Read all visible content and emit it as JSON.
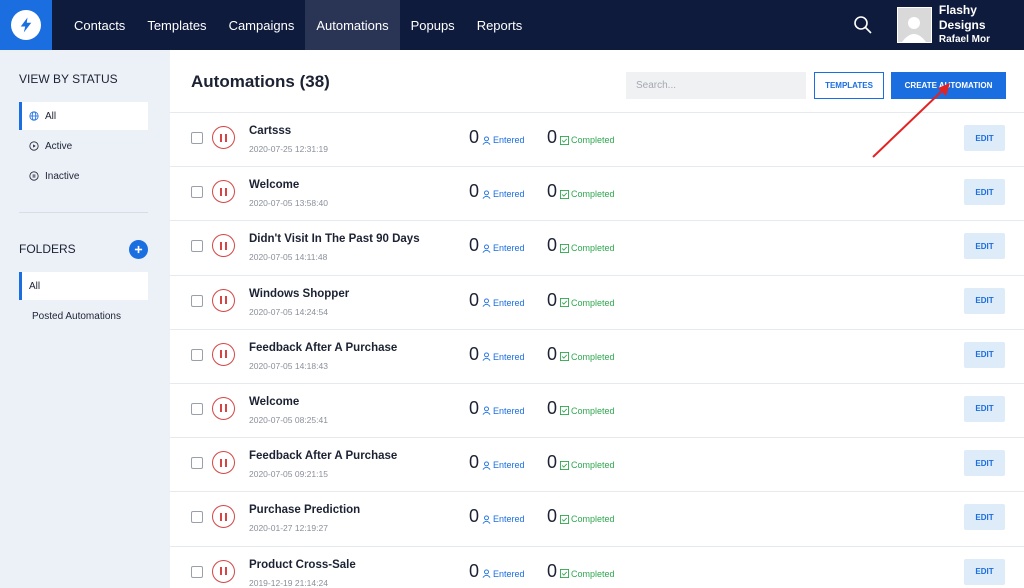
{
  "nav": {
    "items": [
      {
        "label": "Contacts",
        "active": false
      },
      {
        "label": "Templates",
        "active": false
      },
      {
        "label": "Campaigns",
        "active": false
      },
      {
        "label": "Automations",
        "active": true
      },
      {
        "label": "Popups",
        "active": false
      },
      {
        "label": "Reports",
        "active": false
      }
    ]
  },
  "user": {
    "name": "Flashy Designs",
    "sub": "Rafael Mor"
  },
  "sidebar": {
    "status_heading": "VIEW BY STATUS",
    "status_items": [
      {
        "label": "All",
        "icon": "globe-icon",
        "active": true
      },
      {
        "label": "Active",
        "icon": "play-circle-icon",
        "active": false
      },
      {
        "label": "Inactive",
        "icon": "pause-circle-icon",
        "active": false
      }
    ],
    "folders_heading": "FOLDERS",
    "folder_items": [
      {
        "label": "All",
        "active": true
      },
      {
        "label": "Posted Automations",
        "active": false
      }
    ]
  },
  "main": {
    "title": "Automations (38)",
    "search_placeholder": "Search...",
    "templates_label": "TEMPLATES",
    "create_label": "CREATE AUTOMATION",
    "entered_label": "Entered",
    "completed_label": "Completed",
    "edit_label": "EDIT",
    "rows": [
      {
        "name": "Cartsss",
        "date": "2020-07-25 12:31:19",
        "entered": "0",
        "completed": "0"
      },
      {
        "name": "Welcome",
        "date": "2020-07-05 13:58:40",
        "entered": "0",
        "completed": "0"
      },
      {
        "name": "Didn't Visit In The Past 90 Days",
        "date": "2020-07-05 14:11:48",
        "entered": "0",
        "completed": "0"
      },
      {
        "name": "Windows Shopper",
        "date": "2020-07-05 14:24:54",
        "entered": "0",
        "completed": "0"
      },
      {
        "name": "Feedback After A Purchase",
        "date": "2020-07-05 14:18:43",
        "entered": "0",
        "completed": "0"
      },
      {
        "name": "Welcome",
        "date": "2020-07-05 08:25:41",
        "entered": "0",
        "completed": "0"
      },
      {
        "name": "Feedback After A Purchase",
        "date": "2020-07-05 09:21:15",
        "entered": "0",
        "completed": "0"
      },
      {
        "name": "Purchase Prediction",
        "date": "2020-01-27 12:19:27",
        "entered": "0",
        "completed": "0"
      },
      {
        "name": "Product Cross-Sale",
        "date": "2019-12-19 21:14:24",
        "entered": "0",
        "completed": "0"
      }
    ]
  },
  "colors": {
    "nav_bg": "#0f1b3d",
    "accent": "#1a6ee0",
    "pause_red": "#d64545",
    "completed_green": "#2fa84f",
    "annotation_arrow": "#e32222"
  }
}
